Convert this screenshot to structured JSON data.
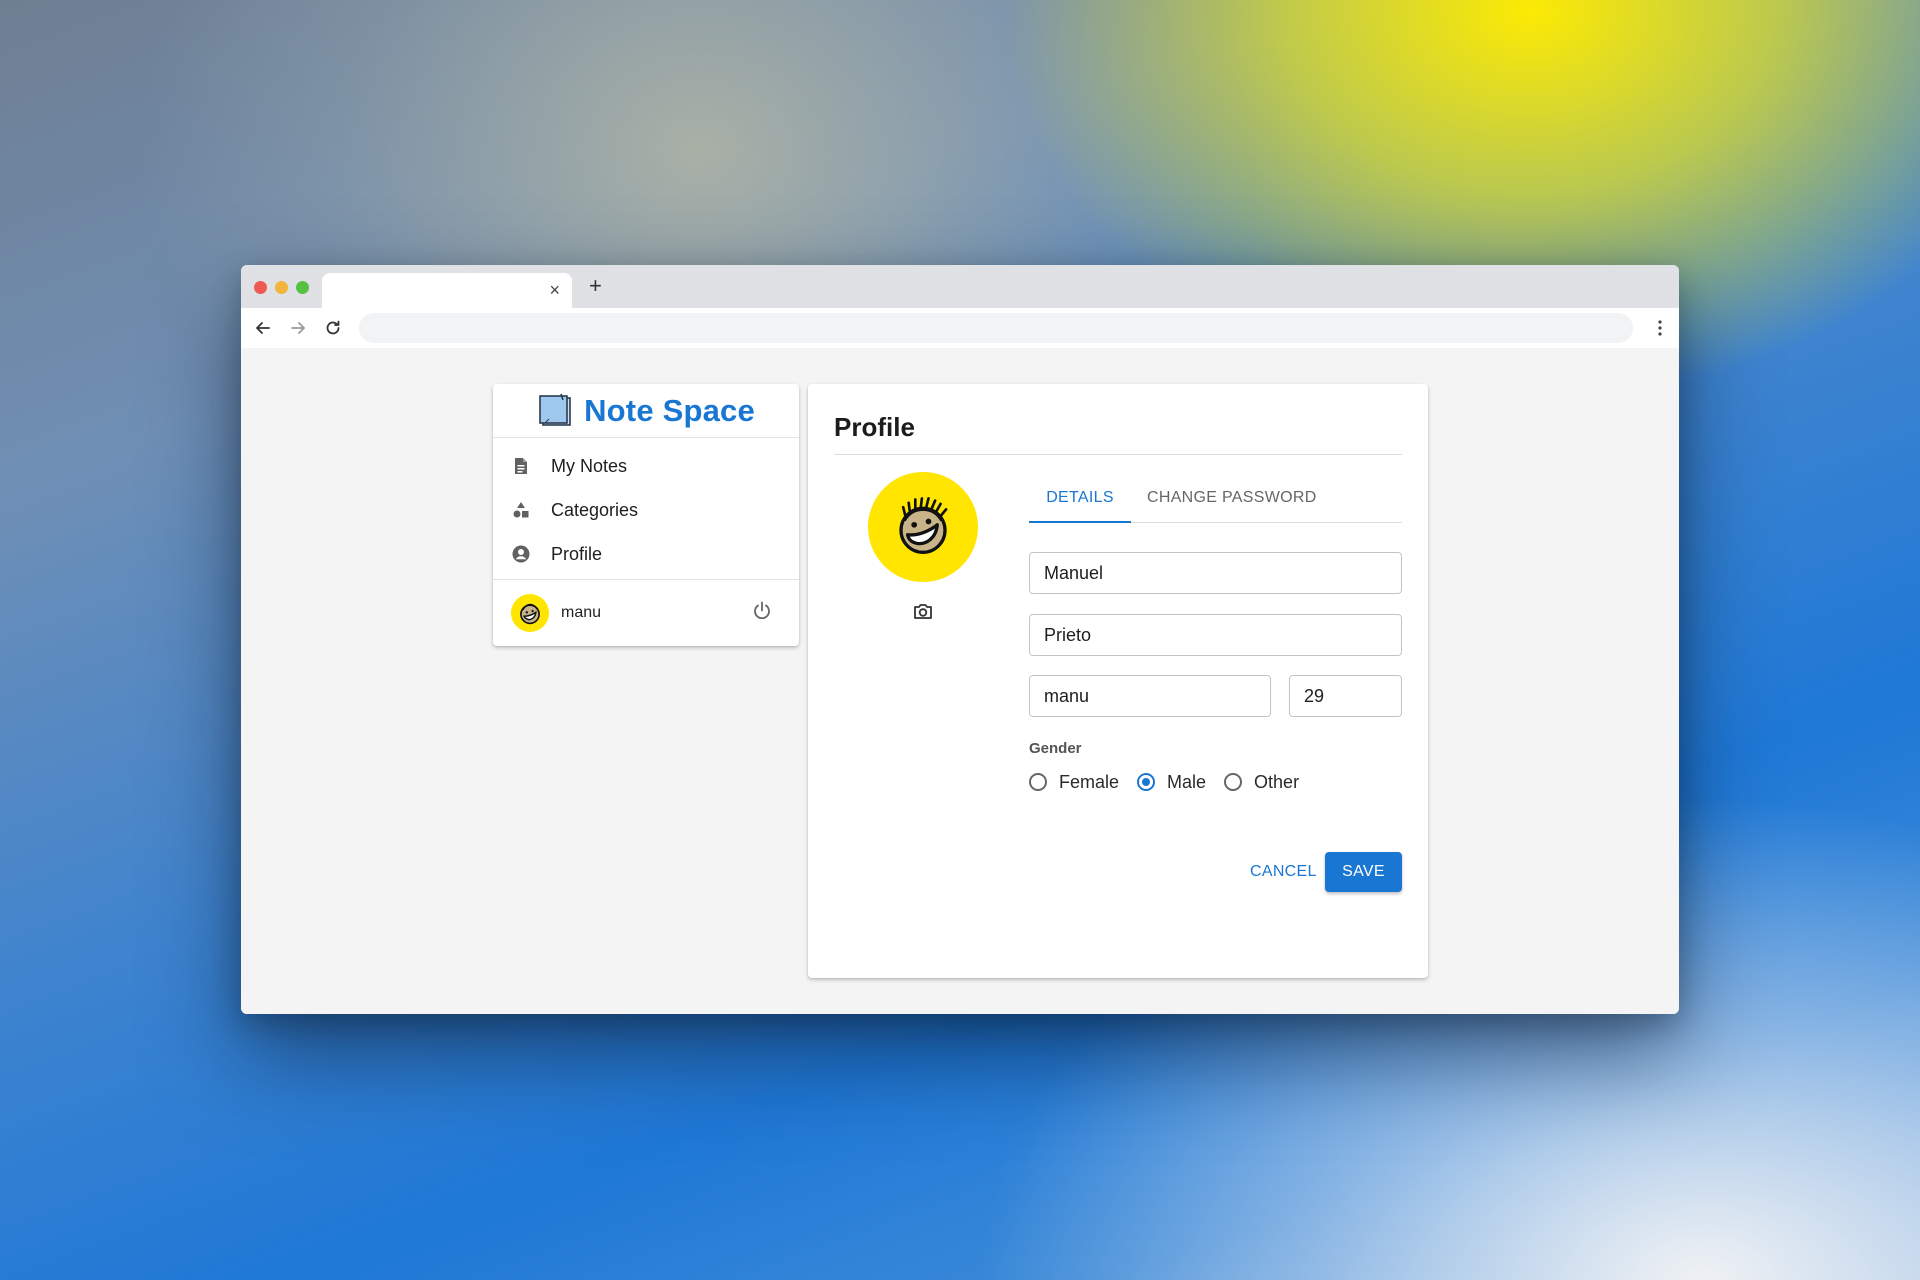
{
  "browser": {
    "tab_close": "×",
    "new_tab": "+"
  },
  "app": {
    "brand": "Note Space",
    "brand_color": "#1976d2",
    "nav": [
      {
        "label": "My Notes",
        "icon": "document-icon"
      },
      {
        "label": "Categories",
        "icon": "shapes-icon"
      },
      {
        "label": "Profile",
        "icon": "account-circle-icon"
      }
    ],
    "user": {
      "name": "manu"
    }
  },
  "profile": {
    "title": "Profile",
    "tabs": {
      "details": "DETAILS",
      "password": "CHANGE PASSWORD",
      "active": "DETAILS"
    },
    "fields": {
      "first_name": "Manuel",
      "last_name": "Prieto",
      "username": "manu",
      "age": "29"
    },
    "gender": {
      "label": "Gender",
      "options": [
        "Female",
        "Male",
        "Other"
      ],
      "selected": "Male"
    },
    "actions": {
      "cancel": "CANCEL",
      "save": "SAVE"
    },
    "avatar_color": "#ffe500"
  }
}
